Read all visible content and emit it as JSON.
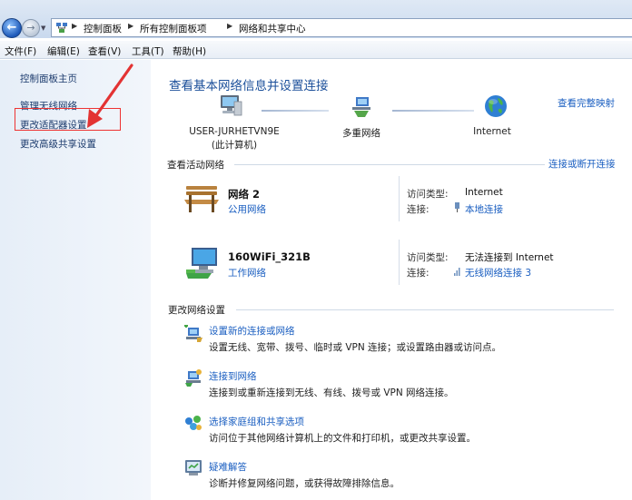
{
  "breadcrumb": [
    "控制面板",
    "所有控制面板项",
    "网络和共享中心"
  ],
  "menu": [
    "文件(F)",
    "编辑(E)",
    "查看(V)",
    "工具(T)",
    "帮助(H)"
  ],
  "sidebar": {
    "items": [
      {
        "label": "控制面板主页"
      },
      {
        "label": "管理无线网络"
      },
      {
        "label": "更改适配器设置"
      },
      {
        "label": "更改高级共享设置"
      }
    ],
    "highlighted_index": 2
  },
  "main": {
    "title": "查看基本网络信息并设置连接",
    "full_map_link": "查看完整映射",
    "map": {
      "computer_line1": "USER-JURHETVN9E",
      "computer_line2": "(此计算机)",
      "middle": "多重网络",
      "internet": "Internet"
    },
    "active_header": "查看活动网络",
    "connect_disconnect": "连接或断开连接",
    "networks": [
      {
        "name": "网络  2",
        "type": "公用网络",
        "access_key": "访问类型:",
        "access_val": "Internet",
        "conn_key": "连接:",
        "conn_val": "本地连接"
      },
      {
        "name": "160WiFi_321B",
        "type": "工作网络",
        "access_key": "访问类型:",
        "access_val": "无法连接到 Internet",
        "conn_key": "连接:",
        "conn_val": "无线网络连接 3"
      }
    ],
    "change_header": "更改网络设置",
    "tasks": [
      {
        "title": "设置新的连接或网络",
        "desc": "设置无线、宽带、拨号、临时或 VPN 连接；或设置路由器或访问点。"
      },
      {
        "title": "连接到网络",
        "desc": "连接到或重新连接到无线、有线、拨号或 VPN 网络连接。"
      },
      {
        "title": "选择家庭组和共享选项",
        "desc": "访问位于其他网络计算机上的文件和打印机，或更改共享设置。"
      },
      {
        "title": "疑难解答",
        "desc": "诊断并修复网络问题，或获得故障排除信息。"
      }
    ]
  },
  "colors": {
    "link": "#1b5fc1",
    "title": "#1b4f9a",
    "annotation": "#e33333"
  }
}
